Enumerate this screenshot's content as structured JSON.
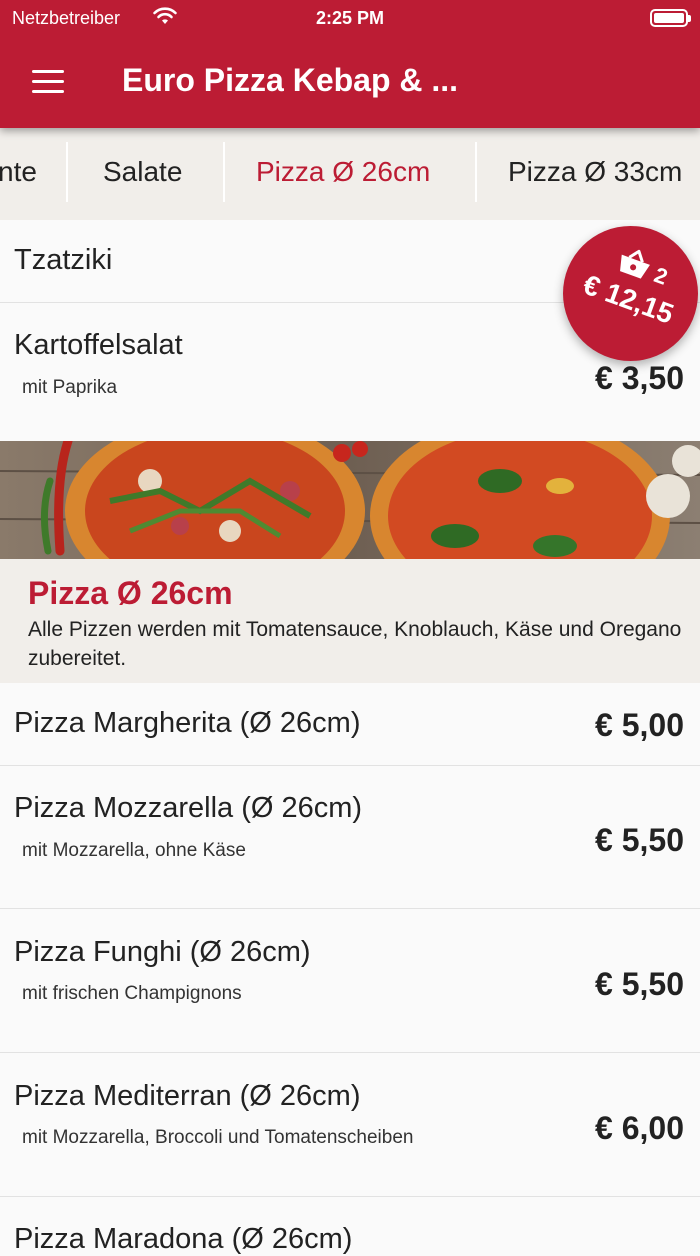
{
  "status_bar": {
    "carrier": "Netzbetreiber",
    "time": "2:25 PM"
  },
  "header": {
    "title": "Euro Pizza Kebap & ..."
  },
  "tabs": [
    {
      "label": "nte"
    },
    {
      "label": "Salate"
    },
    {
      "label": "Pizza Ø 26cm",
      "active": true
    },
    {
      "label": "Pizza Ø 33cm"
    }
  ],
  "cart": {
    "count": "2",
    "total": "€ 12,15"
  },
  "salate_items": [
    {
      "name": "Tzatziki"
    },
    {
      "name": "Kartoffelsalat",
      "desc": "mit Paprika",
      "price": "€ 3,50"
    }
  ],
  "section": {
    "title": "Pizza Ø 26cm",
    "desc": "Alle Pizzen werden mit Tomatensauce, Knoblauch, Käse und Oregano zubereitet."
  },
  "pizza_items": [
    {
      "name": "Pizza Margherita (Ø 26cm)",
      "price": "€ 5,00"
    },
    {
      "name": "Pizza Mozzarella (Ø 26cm)",
      "desc": "mit Mozzarella, ohne Käse",
      "price": "€ 5,50"
    },
    {
      "name": "Pizza Funghi (Ø 26cm)",
      "desc": "mit frischen Champignons",
      "price": "€ 5,50"
    },
    {
      "name": "Pizza Mediterran (Ø 26cm)",
      "desc": "mit Mozzarella, Broccoli und Tomatenscheiben",
      "price": "€ 6,00"
    },
    {
      "name": "Pizza Maradona (Ø 26cm)"
    }
  ],
  "colors": {
    "brand": "#bc1c34",
    "tab_bar": "#f1eeea"
  },
  "icons": [
    "wifi-icon",
    "battery-icon",
    "menu-icon",
    "basket-icon"
  ]
}
